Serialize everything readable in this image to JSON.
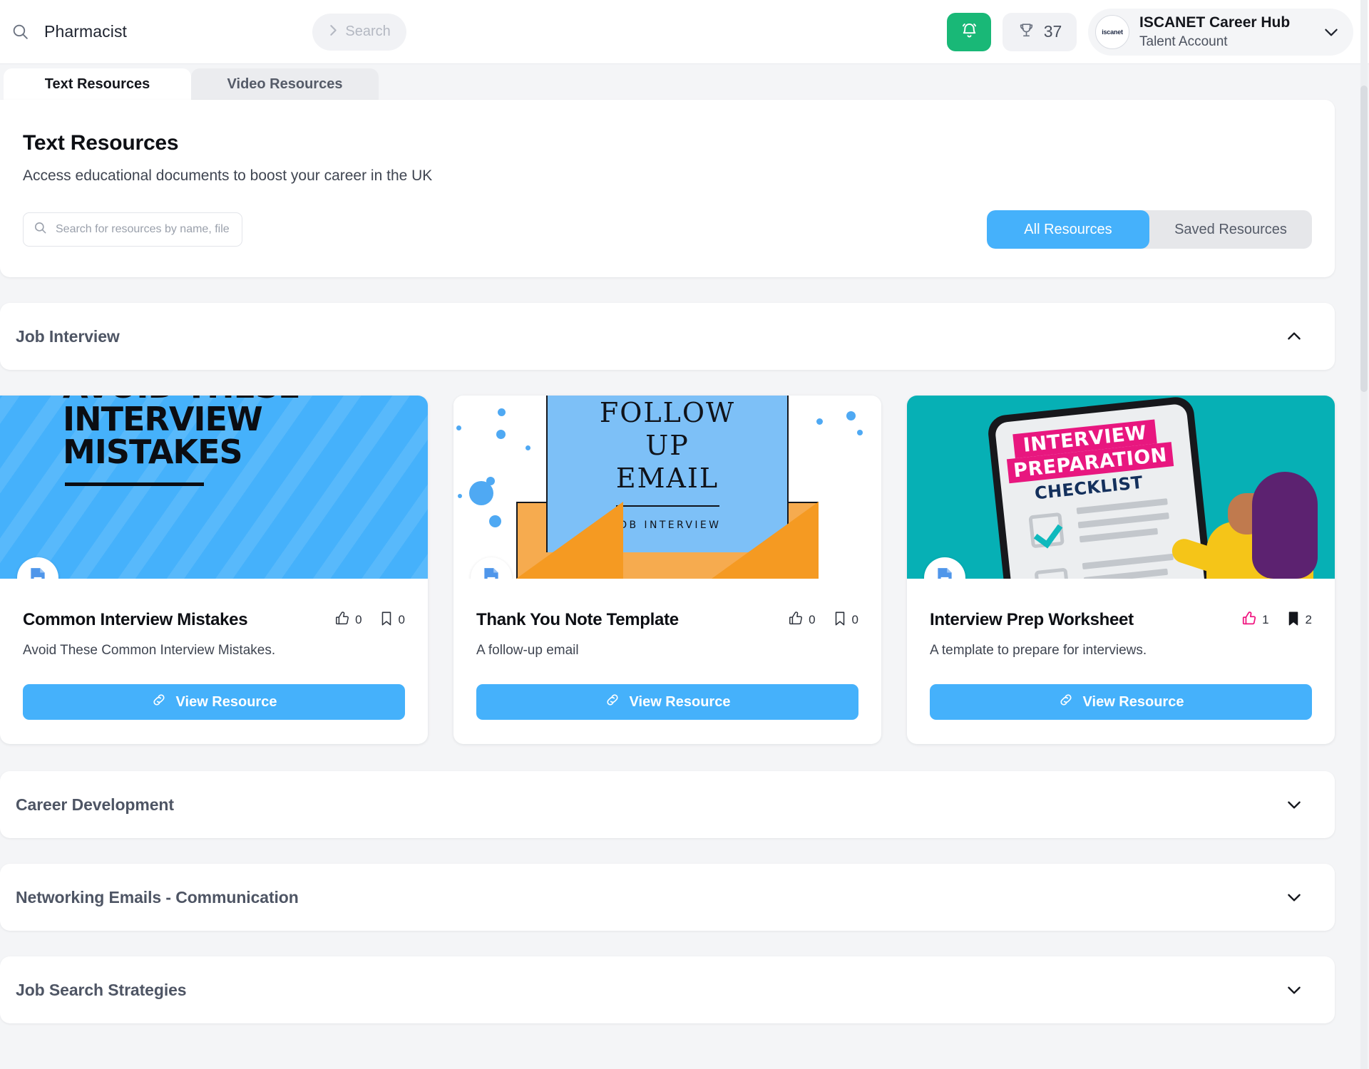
{
  "topbar": {
    "search_icon": "search-icon",
    "search_term": "Pharmacist",
    "search_button_label": "Search",
    "notifications_icon": "bell-ringing-icon",
    "points_icon": "trophy-icon",
    "points_value": "37",
    "avatar_logo_text": "iscanet",
    "account_name": "ISCANET Career Hub",
    "account_type": "Talent Account",
    "account_chevron_icon": "chevron-down-icon",
    "accent_green": "#19b877",
    "accent_blue": "#45b1fb"
  },
  "tabs": [
    {
      "label": "Text Resources",
      "active": true
    },
    {
      "label": "Video Resources",
      "active": false
    }
  ],
  "hero": {
    "title": "Text Resources",
    "subtitle": "Access educational documents to boost your career in the UK",
    "search_placeholder": "Search for resources by name, file type, or category",
    "search_value": "",
    "search_icon": "search-icon",
    "filters": [
      {
        "label": "All Resources",
        "active": true
      },
      {
        "label": "Saved Resources",
        "active": false
      }
    ]
  },
  "sections": [
    {
      "title": "Job Interview",
      "expanded": true,
      "chevron_icon": "chevron-up-icon",
      "cards": [
        {
          "thumb_type": "avoid-mistakes-banner",
          "thumb_line1": "AVOID THESE",
          "thumb_line2": "INTERVIEW",
          "thumb_line3": "MISTAKES",
          "file_icon": "google-docs-file-icon",
          "title": "Common Interview Mistakes",
          "description": "Avoid These Common Interview Mistakes.",
          "like_icon": "thumbs-up-icon",
          "like_count": "0",
          "liked": false,
          "save_icon": "bookmark-icon",
          "save_count": "0",
          "saved": false,
          "button_icon": "link-icon",
          "button_label": "View Resource"
        },
        {
          "thumb_type": "follow-up-email-envelope",
          "thumb_line1": "FOLLOW",
          "thumb_line2": "UP",
          "thumb_line3": "EMAIL",
          "thumb_caption": "JOB INTERVIEW",
          "file_icon": "google-docs-file-icon",
          "title": "Thank You Note Template",
          "description": "A follow-up email",
          "like_icon": "thumbs-up-icon",
          "like_count": "0",
          "liked": false,
          "save_icon": "bookmark-icon",
          "save_count": "0",
          "saved": false,
          "button_icon": "link-icon",
          "button_label": "View Resource"
        },
        {
          "thumb_type": "interview-prep-checklist",
          "thumb_line1": "INTERVIEW",
          "thumb_line2": "PREPARATION",
          "thumb_line3": "CHECKLIST",
          "file_icon": "google-docs-file-icon",
          "title": "Interview Prep Worksheet",
          "description": "A template to prepare for interviews.",
          "like_icon": "thumbs-up-icon",
          "like_count": "1",
          "liked": true,
          "save_icon": "bookmark-icon",
          "save_count": "2",
          "saved": true,
          "button_icon": "link-icon",
          "button_label": "View Resource"
        }
      ]
    },
    {
      "title": "Career Development",
      "expanded": false,
      "chevron_icon": "chevron-down-icon",
      "cards": []
    },
    {
      "title": "Networking Emails - Communication",
      "expanded": false,
      "chevron_icon": "chevron-down-icon",
      "cards": []
    },
    {
      "title": "Job Search Strategies",
      "expanded": false,
      "chevron_icon": "chevron-down-icon",
      "cards": []
    }
  ]
}
